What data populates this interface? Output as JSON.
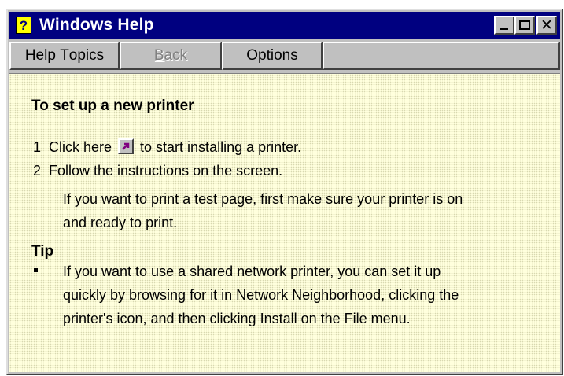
{
  "window": {
    "title": "Windows Help",
    "app_icon_glyph": "?",
    "controls": {
      "minimize": "minimize",
      "maximize": "maximize",
      "close": "✕"
    }
  },
  "toolbar": {
    "help_topics": {
      "prefix": "Help ",
      "accel": "T",
      "rest": "opics"
    },
    "back": {
      "accel": "B",
      "rest": "ack"
    },
    "options": {
      "accel": "O",
      "rest": "ptions"
    }
  },
  "content": {
    "heading": "To set up a new printer",
    "steps": [
      {
        "number": "1",
        "before": "Click here",
        "after": "to start installing a printer."
      },
      {
        "number": "2",
        "text": "Follow the instructions on the screen."
      }
    ],
    "note_line1": "If you want to print a test page, first make sure your printer is on",
    "note_line2": "and ready to print.",
    "tip_heading": "Tip",
    "tip_lines": [
      "If you want to use a shared network printer, you can set it up",
      "quickly by browsing for it in Network Neighborhood, clicking the",
      "printer's icon, and then clicking Install on the File menu."
    ]
  },
  "icons": {
    "app_icon": "help-book-icon",
    "shortcut": "shortcut-jump-icon"
  },
  "colors": {
    "titlebar": "#000080",
    "content_background": "#ffffdd",
    "chrome": "#c0c0c0",
    "shortcut_arrow": "#800080"
  }
}
